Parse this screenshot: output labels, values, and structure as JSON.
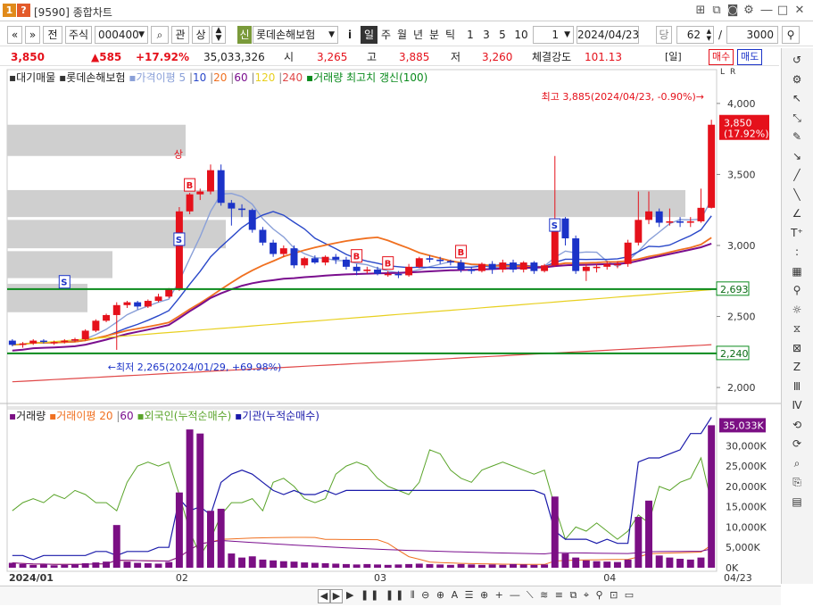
{
  "window": {
    "code": "[9590]",
    "title": "종합차트",
    "badge1": "1",
    "badge2": "?"
  },
  "toolbar": {
    "nav_prev": "«",
    "nav_next": "»",
    "tab_all": "전",
    "market": "주식",
    "stock_code": "000400",
    "btn_search": "⌕",
    "btn_related": "관",
    "btn_up": "상",
    "btn_credit": "신",
    "stock_name": "롯데손해보험",
    "btn_info": "i",
    "periods": [
      "일",
      "주",
      "월",
      "년",
      "분",
      "틱"
    ],
    "multipliers": [
      "1",
      "3",
      "5",
      "10"
    ],
    "count_value": "1",
    "date": "2024/04/23",
    "btn_date": "당",
    "bar_count": "62",
    "slash": "/",
    "max_count": "3000"
  },
  "pricebar": {
    "price": "3,850",
    "change": "▲585",
    "change_pct": "+17.92%",
    "volume": "35,033,326",
    "open_label": "시",
    "open": "3,265",
    "high_label": "고",
    "high": "3,885",
    "low_label": "저",
    "low": "3,260",
    "strength_label": "체결강도",
    "strength": "101.13",
    "period_label": "[일]",
    "buy": "매수",
    "sell": "매도"
  },
  "legend_price": {
    "item1": "대기매물",
    "item2": "롯데손해보험",
    "ma_label": "가격이평",
    "ma5": "5",
    "ma10": "10",
    "ma20": "20",
    "ma60": "60",
    "ma120": "120",
    "ma240": "240",
    "newhigh": "거래량 최고치 갱신(100)"
  },
  "legend_vol": {
    "vol": "거래량",
    "vol_ma": "거래이평",
    "vol_ma20": "20",
    "vol_ma60": "60",
    "foreign": "외국인(누적순매수)",
    "inst": "기관(누적순매수)"
  },
  "annotations": {
    "high_note": "최고 3,885(2024/04/23, -0.90%)→",
    "low_note": "←최저 2,265(2024/01/29, +69.98%)",
    "last_price": "3,850",
    "last_pct": "(17.92%)",
    "line1_label": "2,693",
    "line2_label": "2,240",
    "vol_last": "35,033K",
    "upper_limit": "상",
    "marker_b": "B",
    "marker_s": "S",
    "scale_a": "L",
    "scale_b": "R"
  },
  "price_axis": [
    "4,000",
    "3,500",
    "3,000",
    "2,500",
    "2,000"
  ],
  "volume_axis": [
    "30,000K",
    "25,000K",
    "20,000K",
    "15,000K",
    "10,000K",
    "5,000K",
    "0K"
  ],
  "date_axis": [
    "2024/01",
    "02",
    "03",
    "04",
    "04/23"
  ],
  "colors": {
    "up": "#e5111b",
    "down": "#1b33c8",
    "ma5": "#8aa0d8",
    "ma10": "#2a48c9",
    "ma20": "#f07020",
    "ma60": "#7a0e8e",
    "ma120": "#e8d020",
    "ma240": "#e04848",
    "newhigh": "#0a8a1c",
    "volume": "#7b0f84",
    "foreign": "#5aa42a",
    "inst": "#1a1aaa"
  },
  "chart_data": {
    "type": "candlestick",
    "x": [
      "01/15",
      "01/16",
      "01/17",
      "01/18",
      "01/19",
      "01/22",
      "01/23",
      "01/24",
      "01/25",
      "01/26",
      "01/29",
      "01/30",
      "01/31",
      "02/01",
      "02/02",
      "02/05",
      "02/06",
      "02/07",
      "02/08",
      "02/13",
      "02/14",
      "02/15",
      "02/16",
      "02/19",
      "02/20",
      "02/21",
      "02/22",
      "02/23",
      "02/26",
      "02/27",
      "02/28",
      "02/29",
      "03/04",
      "03/05",
      "03/06",
      "03/07",
      "03/08",
      "03/11",
      "03/12",
      "03/13",
      "03/14",
      "03/15",
      "03/18",
      "03/19",
      "03/20",
      "03/21",
      "03/22",
      "03/25",
      "03/26",
      "03/27",
      "03/28",
      "03/29",
      "04/01",
      "04/02",
      "04/03",
      "04/04",
      "04/05",
      "04/08",
      "04/09",
      "04/11",
      "04/12",
      "04/15",
      "04/16",
      "04/17",
      "04/18",
      "04/19",
      "04/22",
      "04/23"
    ],
    "open": [
      2330,
      2300,
      2310,
      2330,
      2320,
      2320,
      2330,
      2340,
      2400,
      2470,
      2510,
      2580,
      2600,
      2570,
      2610,
      2640,
      2690,
      3240,
      3360,
      3380,
      3530,
      3300,
      3260,
      3250,
      3110,
      3020,
      2940,
      2980,
      2860,
      2910,
      2880,
      2920,
      2900,
      2850,
      2820,
      2830,
      2800,
      2800,
      2790,
      2850,
      2910,
      2900,
      2890,
      2880,
      2830,
      2820,
      2870,
      2830,
      2880,
      2830,
      2880,
      2820,
      2860,
      3190,
      3050,
      2820,
      2850,
      2850,
      2870,
      2870,
      3020,
      3180,
      3240,
      3160,
      3170,
      3160,
      3170,
      3265
    ],
    "close": [
      2300,
      2310,
      2330,
      2320,
      2320,
      2330,
      2340,
      2400,
      2470,
      2510,
      2580,
      2600,
      2570,
      2610,
      2640,
      2690,
      3240,
      3360,
      3380,
      3530,
      3300,
      3260,
      3250,
      3110,
      3020,
      2940,
      2980,
      2860,
      2910,
      2880,
      2920,
      2900,
      2850,
      2820,
      2830,
      2800,
      2800,
      2790,
      2850,
      2910,
      2900,
      2890,
      2880,
      2830,
      2820,
      2870,
      2830,
      2880,
      2830,
      2880,
      2820,
      2860,
      3190,
      3050,
      2820,
      2850,
      2850,
      2870,
      2870,
      3020,
      3180,
      3240,
      3160,
      3170,
      3160,
      3170,
      3265,
      3850
    ],
    "high": [
      2340,
      2320,
      2340,
      2340,
      2330,
      2340,
      2350,
      2410,
      2480,
      2520,
      2600,
      2610,
      2610,
      2620,
      2660,
      2700,
      3270,
      3370,
      3400,
      3570,
      3570,
      3320,
      3290,
      3260,
      3130,
      3040,
      3000,
      3000,
      2920,
      2930,
      2930,
      2940,
      2920,
      2870,
      2850,
      2850,
      2820,
      2820,
      2870,
      2920,
      2930,
      2920,
      2900,
      2900,
      2850,
      2880,
      2890,
      2900,
      2900,
      2890,
      2890,
      2870,
      3630,
      3200,
      3070,
      2870,
      2870,
      2890,
      2890,
      3040,
      3380,
      3380,
      3260,
      3260,
      3200,
      3200,
      3400,
      3885
    ],
    "low": [
      2290,
      2280,
      2300,
      2310,
      2300,
      2310,
      2320,
      2330,
      2390,
      2460,
      2265,
      2560,
      2550,
      2560,
      2600,
      2630,
      2680,
      3220,
      3320,
      3360,
      3280,
      3140,
      3200,
      3090,
      3000,
      2920,
      2920,
      2840,
      2840,
      2870,
      2860,
      2870,
      2830,
      2790,
      2800,
      2790,
      2780,
      2770,
      2780,
      2840,
      2880,
      2870,
      2860,
      2810,
      2800,
      2810,
      2800,
      2810,
      2810,
      2810,
      2800,
      2810,
      2850,
      3000,
      2800,
      2750,
      2810,
      2830,
      2840,
      2850,
      3000,
      3150,
      3130,
      3140,
      3130,
      3130,
      3160,
      3260
    ],
    "volume_k": [
      1200,
      900,
      700,
      800,
      600,
      700,
      900,
      1100,
      1300,
      1500,
      10500,
      1500,
      1200,
      1100,
      1000,
      1400,
      18500,
      34000,
      33000,
      14000,
      14500,
      3500,
      2500,
      2800,
      2000,
      1800,
      1600,
      1500,
      1300,
      1200,
      1100,
      1000,
      900,
      800,
      900,
      800,
      700,
      800,
      900,
      1000,
      900,
      800,
      700,
      900,
      800,
      700,
      800,
      700,
      900,
      800,
      700,
      800,
      17500,
      3500,
      2500,
      1800,
      1600,
      1500,
      1400,
      2000,
      12500,
      16500,
      3000,
      2500,
      2200,
      2000,
      2500,
      35033
    ],
    "ylim_price": [
      1900,
      4150
    ],
    "ylim_volume_k": [
      0,
      36000
    ],
    "lines": [
      {
        "price": 2693
      },
      {
        "price": 2240
      }
    ]
  },
  "bottom": {
    "scroll_left": "◀",
    "scroll_right": "▶",
    "tools": "▶ ❚❚ ❚❚ ⦀ ⊖ ⊕ A ☰ ⊕ + ― ⟍ ≋ ≡ ⧉ ⌖ ⚲ ⊡ ▭"
  },
  "sidebar_icons": [
    "↺",
    "⚙",
    "↖",
    "⤡",
    "✎",
    "↘",
    "╱",
    "╲",
    "∠",
    "T⁺",
    "꞉",
    "▦",
    "⚲",
    "☼",
    "⧖",
    "⊠",
    "Z",
    "Ⅲ",
    "Ⅳ",
    "⟲",
    "⟳",
    "⌕",
    "⎘",
    "▤"
  ]
}
